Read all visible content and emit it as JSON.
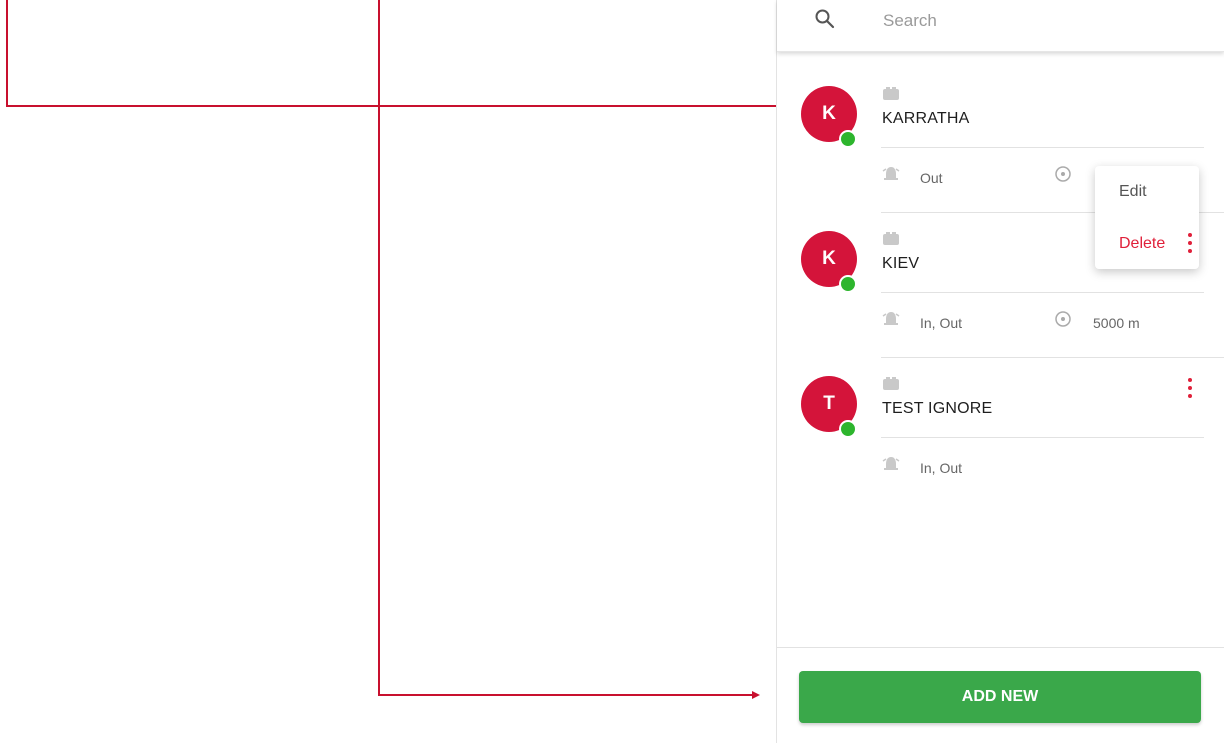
{
  "search": {
    "placeholder": "Search"
  },
  "items": [
    {
      "initial": "K",
      "name": "KARRATHA",
      "trigger": "Out",
      "radius": ""
    },
    {
      "initial": "K",
      "name": "KIEV",
      "trigger": "In, Out",
      "radius": "5000 m"
    },
    {
      "initial": "T",
      "name": "TEST IGNORE",
      "trigger": "In, Out",
      "radius": ""
    }
  ],
  "context_menu": {
    "edit_label": "Edit",
    "delete_label": "Delete"
  },
  "add_button": {
    "label": "ADD NEW"
  },
  "colors": {
    "accent_red": "#d4143a",
    "status_green": "#2db52d",
    "button_green": "#3aa84a",
    "annotation_line": "#c8102e"
  },
  "icons": [
    "search-icon",
    "geofence-type-icon",
    "alarm-icon",
    "radius-icon",
    "more-vert-icon",
    "online-status-icon"
  ]
}
